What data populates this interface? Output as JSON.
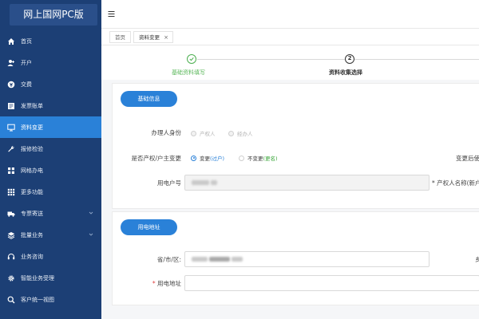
{
  "app": {
    "brand": "网上国网PC版"
  },
  "sidebar": {
    "items": [
      {
        "label": "首页",
        "icon": "home-icon"
      },
      {
        "label": "开户",
        "icon": "user-add-icon"
      },
      {
        "label": "交费",
        "icon": "payment-icon"
      },
      {
        "label": "发票账单",
        "icon": "invoice-icon"
      },
      {
        "label": "资料变更",
        "icon": "monitor-icon",
        "active": true
      },
      {
        "label": "报修检验",
        "icon": "wrench-icon"
      },
      {
        "label": "网格办电",
        "icon": "grid-network-icon"
      },
      {
        "label": "更多功能",
        "icon": "apps-icon"
      },
      {
        "label": "专票寄送",
        "icon": "truck-icon",
        "expandable": true
      },
      {
        "label": "批量业务",
        "icon": "layers-icon",
        "expandable": true
      },
      {
        "label": "业务咨询",
        "icon": "headset-icon"
      },
      {
        "label": "智能业务受理",
        "icon": "gear-icon"
      },
      {
        "label": "客户统一视图",
        "icon": "search-icon"
      }
    ]
  },
  "tabs": {
    "home": "首页",
    "current": "资料变更",
    "close": "×"
  },
  "steps": {
    "step1": {
      "label": "基础资料填写",
      "status": "done"
    },
    "step2": {
      "number": "2",
      "label": "资料收集选择"
    }
  },
  "basic": {
    "title": "基础信息",
    "handler": {
      "label": "办理人身份",
      "opt1": "产权人",
      "opt2": "经办人"
    },
    "owner_change": {
      "label": "是否产权/户主变更",
      "opt1_prefix": "变更",
      "opt1_hint": "(过户)",
      "opt2_prefix": "不变更",
      "opt2_hint": "(更名)"
    },
    "right_label": "变更后使",
    "account": {
      "label": "用电户号",
      "value": ""
    },
    "owner_name_label": "* 产权人名称(新户"
  },
  "address": {
    "title": "用电地址",
    "region": {
      "label": "省/市/区:"
    },
    "right_label": "乡",
    "detail": {
      "label": "用电地址",
      "required_mark": "*"
    }
  },
  "colors": {
    "primary": "#2a81d8",
    "sidebar": "#1c3f75",
    "success": "#5cb85c"
  }
}
